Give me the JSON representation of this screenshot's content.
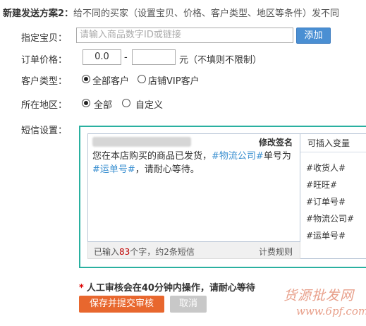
{
  "header": {
    "title": "新建发送方案2：",
    "description": "给不同的买家（设置宝贝、价格、客户类型、地区等条件）发不同"
  },
  "item": {
    "label": "指定宝贝：",
    "placeholder": "请输入商品数字ID或链接",
    "add_button": "添加"
  },
  "price": {
    "label": "订单价格：",
    "min_value": "0.0",
    "max_value": "",
    "separator": "-",
    "unit_note": "元（不填则不限制）"
  },
  "customer": {
    "label": "客户类型：",
    "options": [
      "全部客户",
      "店铺VIP客户"
    ],
    "selected": "全部客户"
  },
  "region": {
    "label": "所在地区：",
    "options": [
      "全部",
      "自定义"
    ],
    "selected": "全部"
  },
  "sms": {
    "label": "短信设置：",
    "edit_signature": "修改签名",
    "content_parts": [
      "您在本店购买的商品已发货，",
      "#物流公司#",
      "单号为",
      "#运单号#",
      "，请耐心等待。"
    ],
    "count_prefix": "已输入",
    "count_number": "83",
    "count_suffix": "个字，约2条短信",
    "billing_rules": "计费规则",
    "variables_title": "可插入变量",
    "variables": [
      "#收货人#",
      "#旺旺#",
      "#订单号#",
      "#物流公司#",
      "#运单号#"
    ]
  },
  "notice": {
    "star": "*",
    "text": "人工审核会在40分钟内操作，请耐心等待"
  },
  "actions": {
    "submit": "保存并提交审核",
    "cancel": "取消"
  },
  "watermark": {
    "line1": "货源批发网",
    "line2": "www.6pf.com"
  }
}
